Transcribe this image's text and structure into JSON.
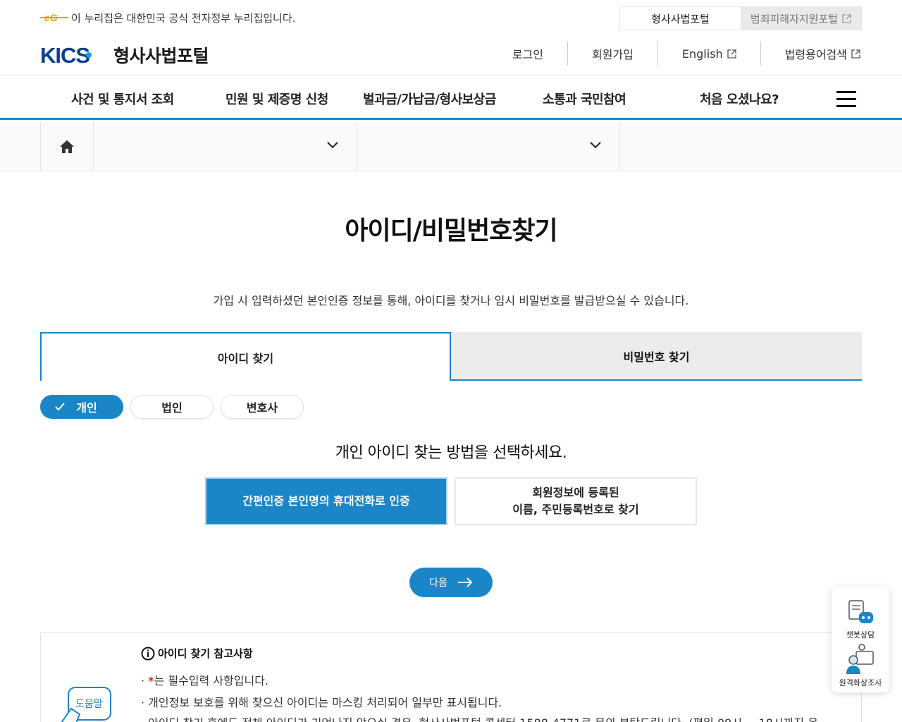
{
  "gov_banner": {
    "text": "이 누리집은 대한민국 공식 전자정부 누리집입니다."
  },
  "portal_switch": [
    {
      "label": "형사사법포털",
      "active": true
    },
    {
      "label": "범죄피해자지원포털",
      "active": false,
      "external": true
    }
  ],
  "brand": {
    "logo": "KICS",
    "title": "형사사법포털"
  },
  "util_nav": [
    {
      "label": "로그인"
    },
    {
      "label": "회원가입"
    },
    {
      "label": "English",
      "external": true
    },
    {
      "label": "법령용어검색",
      "external": true
    }
  ],
  "gnb": [
    "사건 및 통지서 조회",
    "민원 및 제증명 신청",
    "벌과금/가납금/형사보상금",
    "소통과 국민참여",
    "처음 오셨나요?"
  ],
  "page": {
    "title": "아이디/비밀번호찾기",
    "description": "가입 시 입력하셨던 본인인증 정보를 통해, 아이디를 찾거나 임시 비밀번호를 발급받으실 수 있습니다."
  },
  "tabs": [
    {
      "label": "아이디 찾기",
      "active": true
    },
    {
      "label": "비밀번호 찾기",
      "active": false
    }
  ],
  "member_types": [
    {
      "label": "개인",
      "active": true
    },
    {
      "label": "법인",
      "active": false
    },
    {
      "label": "변호사",
      "active": false
    }
  ],
  "method_title": "개인 아이디 찾는 방법을 선택하세요.",
  "methods": [
    {
      "line1": "간편인증 본인명의 휴대전화로 인증",
      "line2": "",
      "active": true
    },
    {
      "line1": "회원정보에 등록된",
      "line2": "이름, 주민등록번호로 찾기",
      "active": false
    }
  ],
  "next_button": "다음",
  "notes": {
    "badge": "도움말",
    "title": "아이디 찾기 참고사항",
    "line1_mark": "*",
    "line1_text": "는 필수입력 사항입니다.",
    "line2": "개인정보 보호를 위해 찾으신 아이디는 마스킹 처리되어 일부만 표시됩니다.",
    "line3": "아이디 찾기 후에도 전체 아이디가 기억나지 않으실 경우, 형사사법포털 콜센터 1588-4771로 문의 부탁드립니다. (평일 09시 ~ 18시까지 운"
  },
  "quick_menu": [
    {
      "label": "챗봇상담",
      "icon": "chatbot-icon"
    },
    {
      "label": "원격화상조사",
      "icon": "video-call-icon"
    }
  ],
  "colors": {
    "primary": "#1a86c8",
    "required": "#e02020"
  }
}
